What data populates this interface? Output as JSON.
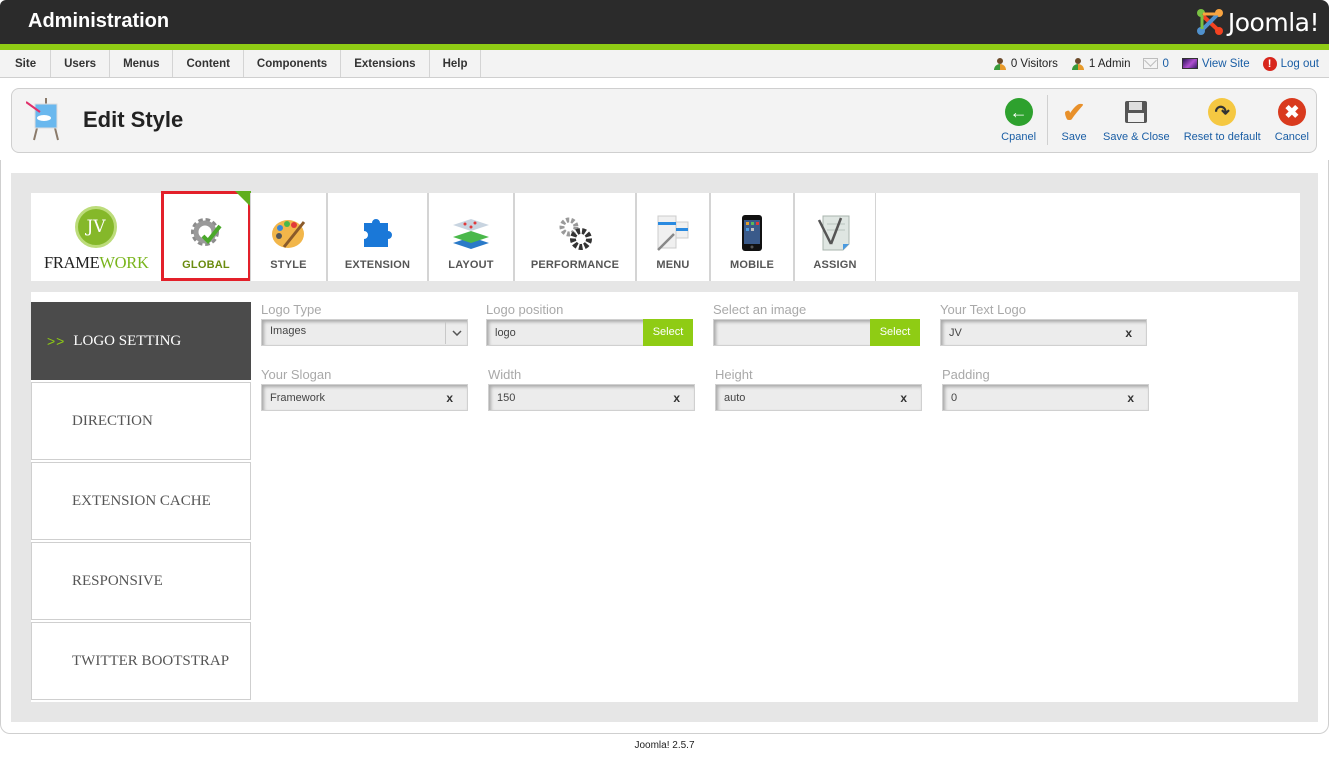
{
  "header": {
    "title": "Administration",
    "logo_text": "Joomla!"
  },
  "menu": {
    "items": [
      "Site",
      "Users",
      "Menus",
      "Content",
      "Components",
      "Extensions",
      "Help"
    ]
  },
  "status": {
    "visitors": "0 Visitors",
    "admins": "1 Admin",
    "messages": "0",
    "view_site": "View Site",
    "logout": "Log out"
  },
  "toolbar": {
    "page_title": "Edit Style",
    "buttons": [
      {
        "label": "Cpanel",
        "icon": "back-arrow-icon",
        "color": "#2ea12e"
      },
      {
        "label": "Save",
        "icon": "checkmark-icon",
        "color": "#e8902a"
      },
      {
        "label": "Save & Close",
        "icon": "floppy-disk-icon",
        "color": "#555555"
      },
      {
        "label": "Reset to default",
        "icon": "reset-arrow-icon",
        "color": "#f5c842"
      },
      {
        "label": "Cancel",
        "icon": "cancel-x-icon",
        "color": "#d93a1e"
      }
    ]
  },
  "brand": {
    "badge": "JV",
    "name_part1": "FRAME",
    "name_part2": "WORK"
  },
  "tabs": [
    {
      "label": "GLOBAL",
      "icon": "gear-check-icon",
      "active": true
    },
    {
      "label": "STYLE",
      "icon": "palette-icon",
      "active": false
    },
    {
      "label": "EXTENSION",
      "icon": "puzzle-piece-icon",
      "active": false
    },
    {
      "label": "LAYOUT",
      "icon": "layers-icon",
      "active": false
    },
    {
      "label": "PERFORMANCE",
      "icon": "gears-icon",
      "active": false
    },
    {
      "label": "MENU",
      "icon": "menu-edit-icon",
      "active": false
    },
    {
      "label": "MOBILE",
      "icon": "phone-icon",
      "active": false
    },
    {
      "label": "ASSIGN",
      "icon": "assign-note-icon",
      "active": false
    }
  ],
  "sidenav": {
    "arrow": ">>",
    "items": [
      {
        "label": "LOGO SETTING",
        "active": true
      },
      {
        "label": "DIRECTION",
        "active": false
      },
      {
        "label": "EXTENSION CACHE",
        "active": false
      },
      {
        "label": "RESPONSIVE",
        "active": false
      },
      {
        "label": "TWITTER BOOTSTRAP",
        "active": false
      }
    ]
  },
  "fields": {
    "logo_type": {
      "label": "Logo Type",
      "value": "Images"
    },
    "logo_position": {
      "label": "Logo position",
      "value": "logo",
      "button": "Select"
    },
    "select_image": {
      "label": "Select an image",
      "value": "",
      "button": "Select"
    },
    "text_logo": {
      "label": "Your Text Logo",
      "value": "JV",
      "clear": "x"
    },
    "slogan": {
      "label": "Your Slogan",
      "value": "Framework",
      "clear": "x"
    },
    "width": {
      "label": "Width",
      "value": "150",
      "clear": "x"
    },
    "height": {
      "label": "Height",
      "value": "auto",
      "clear": "x"
    },
    "padding": {
      "label": "Padding",
      "value": "0",
      "clear": "x"
    }
  },
  "footer": {
    "version": "Joomla! 2.5.7"
  },
  "colors": {
    "accent_green": "#8fcc14",
    "active_tab_border": "#e3202a",
    "header_bg": "#2b2b2b",
    "link_blue": "#1a5ea5"
  }
}
